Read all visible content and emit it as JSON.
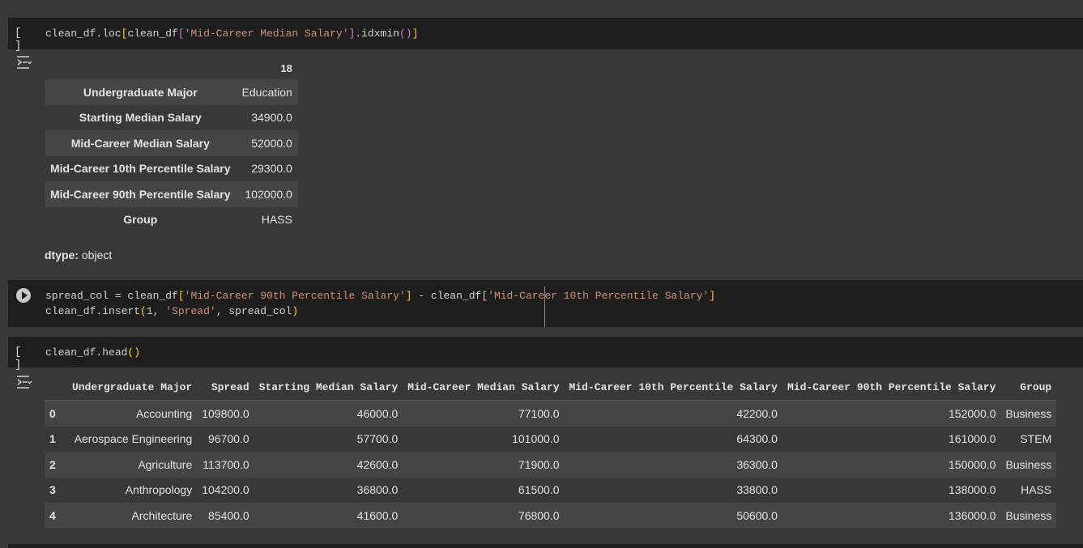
{
  "cells": {
    "cell1": {
      "prompt": "[ ]",
      "code": {
        "prefix": "clean_df.loc",
        "b1": "[",
        "prefix2": "clean_df",
        "b2": "[",
        "str": "'Mid-Career Median Salary'",
        "b3": "]",
        "method": ".idxmin",
        "p1": "(",
        "p2": ")",
        "b4": "]"
      }
    },
    "output1": {
      "index_header": "18",
      "rows": [
        {
          "label": "Undergraduate Major",
          "value": "Education"
        },
        {
          "label": "Starting Median Salary",
          "value": "34900.0"
        },
        {
          "label": "Mid-Career Median Salary",
          "value": "52000.0"
        },
        {
          "label": "Mid-Career 10th Percentile Salary",
          "value": "29300.0"
        },
        {
          "label": "Mid-Career 90th Percentile Salary",
          "value": "102000.0"
        },
        {
          "label": "Group",
          "value": "HASS"
        }
      ],
      "dtype_label": "dtype:",
      "dtype_value": "object"
    },
    "cell2": {
      "line1": {
        "a": "spread_col = clean_df",
        "b1": "[",
        "s1": "'Mid-Career 90th Percentile Salary'",
        "b2": "]",
        "m": " - clean_df",
        "b3": "[",
        "s2": "'Mid-Career 10th Percentile Salary'",
        "b4": "]"
      },
      "line2": {
        "a": "clean_df.insert",
        "p1": "(",
        "n": "1",
        "c1": ", ",
        "s": "'Spread'",
        "c2": ", spread_col",
        "p2": ")"
      }
    },
    "cell3": {
      "prompt": "[ ]",
      "code": {
        "a": "clean_df.head",
        "p1": "(",
        "p2": ")"
      }
    },
    "output3": {
      "columns": [
        "",
        "Undergraduate Major",
        "Spread",
        "Starting Median Salary",
        "Mid-Career Median Salary",
        "Mid-Career 10th Percentile Salary",
        "Mid-Career 90th Percentile Salary",
        "Group"
      ],
      "rows": [
        [
          "0",
          "Accounting",
          "109800.0",
          "46000.0",
          "77100.0",
          "42200.0",
          "152000.0",
          "Business"
        ],
        [
          "1",
          "Aerospace Engineering",
          "96700.0",
          "57700.0",
          "101000.0",
          "64300.0",
          "161000.0",
          "STEM"
        ],
        [
          "2",
          "Agriculture",
          "113700.0",
          "42600.0",
          "71900.0",
          "36300.0",
          "150000.0",
          "Business"
        ],
        [
          "3",
          "Anthropology",
          "104200.0",
          "36800.0",
          "61500.0",
          "33800.0",
          "138000.0",
          "HASS"
        ],
        [
          "4",
          "Architecture",
          "85400.0",
          "41600.0",
          "76800.0",
          "50600.0",
          "136000.0",
          "Business"
        ]
      ]
    }
  }
}
